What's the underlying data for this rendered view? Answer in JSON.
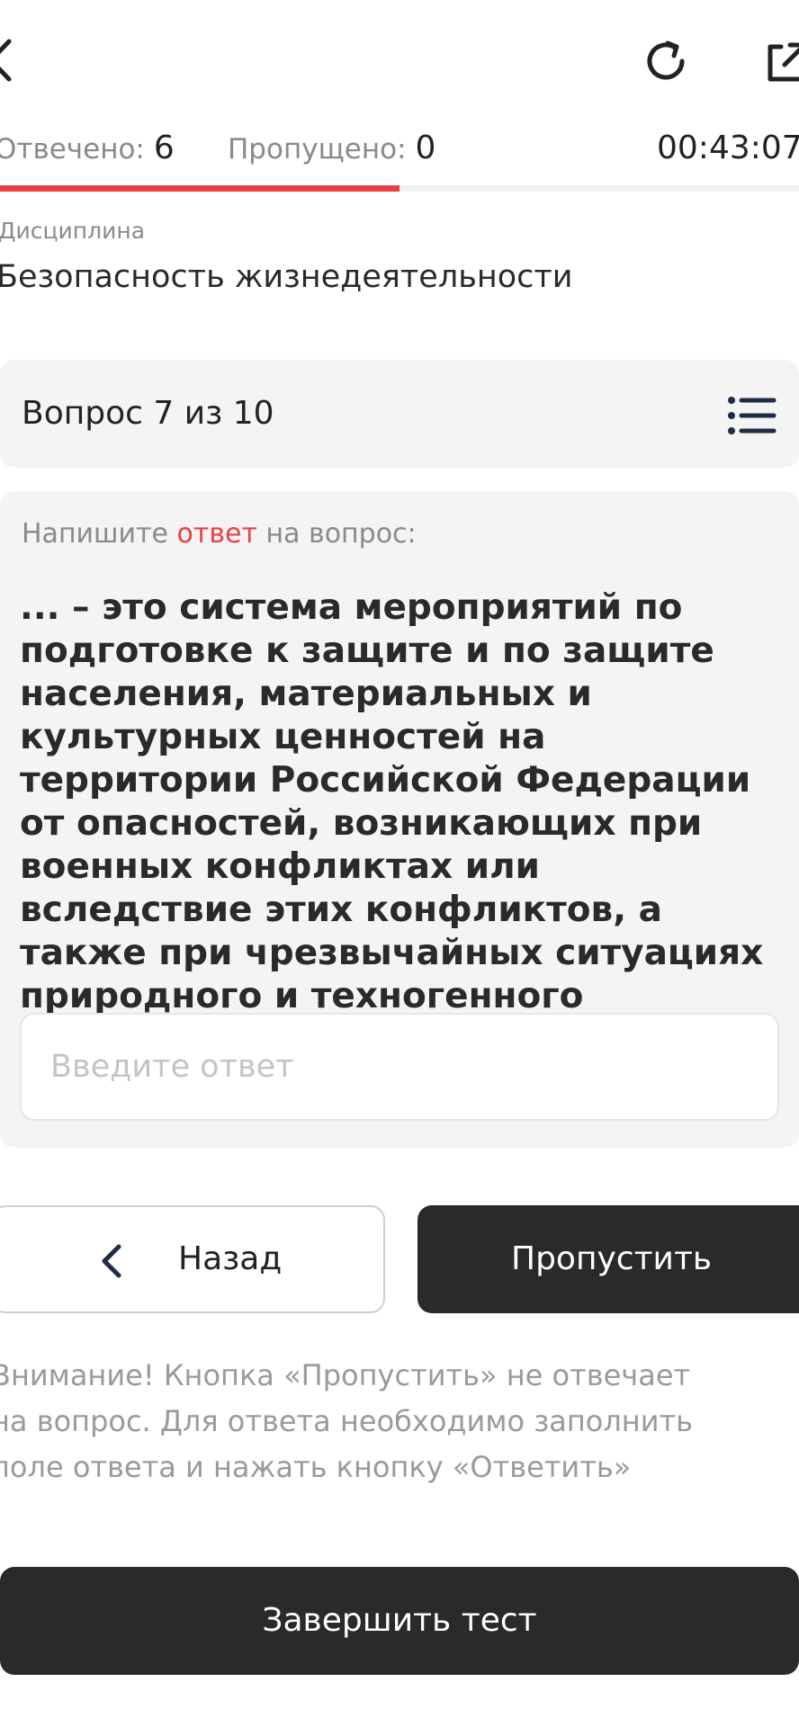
{
  "stats": {
    "answered_label": "Отвечено:",
    "answered_value": "6",
    "skipped_label": "Пропущено:",
    "skipped_value": "0",
    "timer": "00:43:07"
  },
  "progress": {
    "fraction": 0.5
  },
  "discipline": {
    "label": "Дисциплина",
    "value": "Безопасность жизнедеятельности"
  },
  "question_header": {
    "title": "Вопрос 7 из 10"
  },
  "question": {
    "prompt_before": "Напишите ",
    "prompt_accent": "ответ",
    "prompt_after": " на вопрос:",
    "text": "... – это система мероприятий по подготовке к защите и по защите населения, материальных и культурных ценностей на территории Российской Федерации от опасностей, возникающих при военных конфликтах или вследствие этих конфликтов, а также при чрезвычайных ситуациях природного и техногенного характера",
    "answer_placeholder": "Введите ответ",
    "answer_value": ""
  },
  "buttons": {
    "back_label": "Назад",
    "skip_label": "Пропустить",
    "finish_label": "Завершить тест"
  },
  "warning": {
    "lines": [
      "Внимание! Кнопка «Пропустить» не отвечает",
      "на вопрос. Для ответа необходимо заполнить",
      "поле ответа и нажать кнопку «Ответить»"
    ]
  },
  "colors": {
    "accent": "#e84040",
    "dark": "#2a2a2a",
    "card": "#f4f4f4",
    "muted": "#8a8a8a"
  },
  "icons": {
    "back": "chevron-left-icon",
    "refresh": "refresh-icon",
    "share": "share-icon",
    "list": "list-icon"
  }
}
